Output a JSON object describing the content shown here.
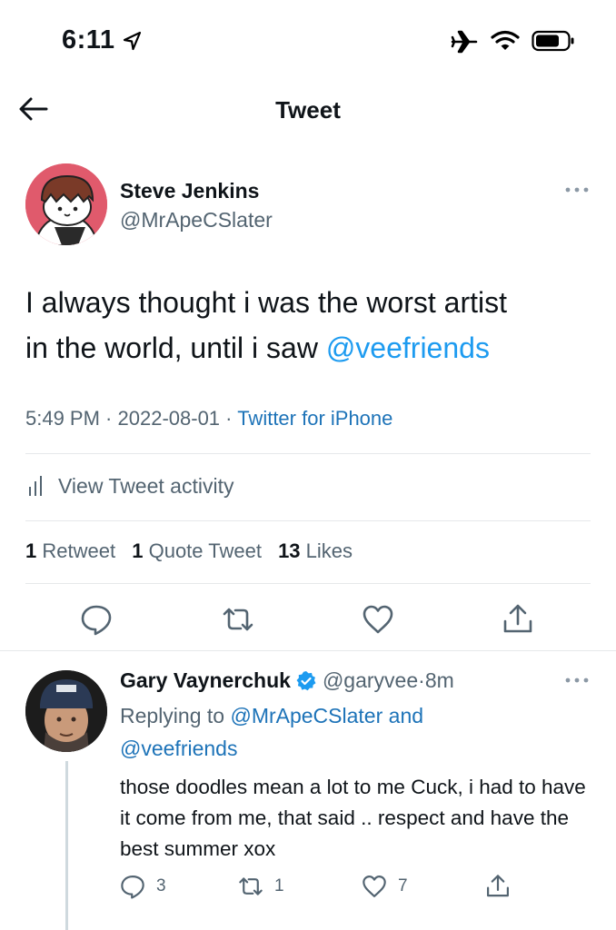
{
  "status_bar": {
    "time": "6:11",
    "icons": [
      "location-arrow-icon",
      "airplane-icon",
      "wifi-icon",
      "battery-icon"
    ]
  },
  "nav": {
    "title": "Tweet",
    "back_icon": "arrow-left-icon"
  },
  "tweet": {
    "author_name": "Steve Jenkins",
    "author_handle": "@MrApeCSlater",
    "text_line1": "I always thought i was the worst artist",
    "text_line2_prefix": "in the world, until i saw ",
    "text_mention": "@veefriends",
    "time": "5:49 PM",
    "sep1": " · ",
    "date": "2022-08-01",
    "sep2": " · ",
    "source": "Twitter for iPhone",
    "activity_label": "View Tweet activity",
    "stats": {
      "retweets_count": "1",
      "retweets_label": "Retweet",
      "quotes_count": "1",
      "quotes_label": "Quote Tweet",
      "likes_count": "13",
      "likes_label": "Likes"
    },
    "actions": [
      "reply-icon",
      "retweet-icon",
      "like-icon",
      "share-icon"
    ]
  },
  "reply": {
    "author_name": "Gary Vaynerchuk",
    "verified": true,
    "author_handle": "@garyvee",
    "sep": " · ",
    "age": "8m",
    "replying_prefix": "Replying to ",
    "replying_mention1": "@MrApeCSlater",
    "replying_and": " and",
    "replying_mention2": "@veefriends",
    "text": "those doodles mean a lot to me Cuck, i had to have it come from me, that said .. respect and have the best summer xox",
    "counts": {
      "replies": "3",
      "retweets": "1",
      "likes": "7"
    }
  },
  "colors": {
    "link": "#1d9bf0",
    "secondary_text": "#536471",
    "verified": "#1d9bf0",
    "avatar1_bg": "#e05a6c"
  }
}
